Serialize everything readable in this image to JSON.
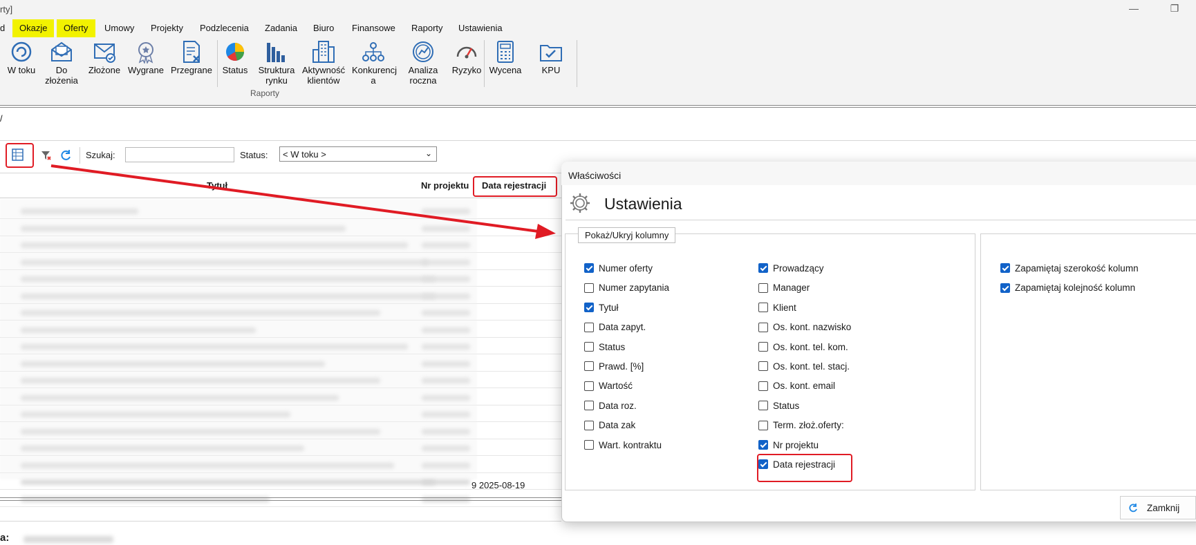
{
  "window": {
    "title": "rty]",
    "minimize": "—",
    "maximize": "❐"
  },
  "menu": {
    "partial": "d",
    "items": [
      "Okazje",
      "Oferty",
      "Umowy",
      "Projekty",
      "Podzlecenia",
      "Zadania",
      "Biuro",
      "Finansowe",
      "Raporty",
      "Ustawienia"
    ],
    "highlight_color": "#f2f200"
  },
  "ribbon": {
    "buttons": [
      {
        "label": "W toku",
        "icon": "spiral-icon"
      },
      {
        "label": "Do\nzłożenia",
        "icon": "envelope-open-icon"
      },
      {
        "label": "Złożone",
        "icon": "envelope-check-icon"
      },
      {
        "label": "Wygrane",
        "icon": "medal-icon"
      },
      {
        "label": "Przegrane",
        "icon": "document-x-icon"
      },
      {
        "label": "Status",
        "icon": "pie-chart-icon"
      },
      {
        "label": "Struktura\nrynku",
        "icon": "bar-chart-icon"
      },
      {
        "label": "Aktywność\nklientów",
        "icon": "buildings-icon"
      },
      {
        "label": "Konkurencj\na",
        "icon": "network-icon"
      },
      {
        "label": "Analiza\nroczna",
        "icon": "gauge-circle-icon"
      },
      {
        "label": "Ryzyko",
        "icon": "speedometer-icon"
      },
      {
        "label": "Wycena",
        "icon": "calculator-icon"
      },
      {
        "label": "KPU",
        "icon": "folder-check-icon"
      }
    ],
    "group_label": "Raporty"
  },
  "breadcrumb_partial": "/",
  "toolbar": {
    "search_label": "Szukaj:",
    "search_value": "",
    "status_label": "Status:",
    "status_value": "< W toku >"
  },
  "grid": {
    "headers": {
      "title": "Tytuł",
      "project": "Nr projektu",
      "reg_date": "Data rejestracji"
    },
    "visible_cells": [
      "9 2025-08-19"
    ]
  },
  "footer_partial": "a:",
  "dialog": {
    "title": "Właściwości",
    "heading": "Ustawienia",
    "group_label": "Pokaż/Ukryj kolumny",
    "col1": [
      {
        "label": "Numer oferty",
        "checked": true
      },
      {
        "label": "Numer zapytania",
        "checked": false
      },
      {
        "label": "Tytuł",
        "checked": true
      },
      {
        "label": "Data zapyt.",
        "checked": false
      },
      {
        "label": "Status",
        "checked": false
      },
      {
        "label": "Prawd. [%]",
        "checked": false
      },
      {
        "label": "Wartość",
        "checked": false
      },
      {
        "label": "Data roz.",
        "checked": false
      },
      {
        "label": "Data zak",
        "checked": false
      },
      {
        "label": "Wart. kontraktu",
        "checked": false
      }
    ],
    "col2": [
      {
        "label": "Prowadzący",
        "checked": true
      },
      {
        "label": "Manager",
        "checked": false
      },
      {
        "label": "Klient",
        "checked": false
      },
      {
        "label": "Os. kont. nazwisko",
        "checked": false
      },
      {
        "label": "Os. kont. tel. kom.",
        "checked": false
      },
      {
        "label": "Os. kont. tel. stacj.",
        "checked": false
      },
      {
        "label": "Os. kont. email",
        "checked": false
      },
      {
        "label": "Status",
        "checked": false
      },
      {
        "label": "Term. złoż.oferty:",
        "checked": false
      },
      {
        "label": "Nr projektu",
        "checked": true
      },
      {
        "label": "Data rejestracji",
        "checked": true
      }
    ],
    "col3": [
      {
        "label": "Zapamiętaj szerokość kolumn",
        "checked": true
      },
      {
        "label": "Zapamiętaj kolejność kolumn",
        "checked": true
      }
    ],
    "close_label": "Zamknij"
  },
  "colors": {
    "annotation_red": "#e01b24",
    "checkbox_blue": "#1162c8"
  }
}
